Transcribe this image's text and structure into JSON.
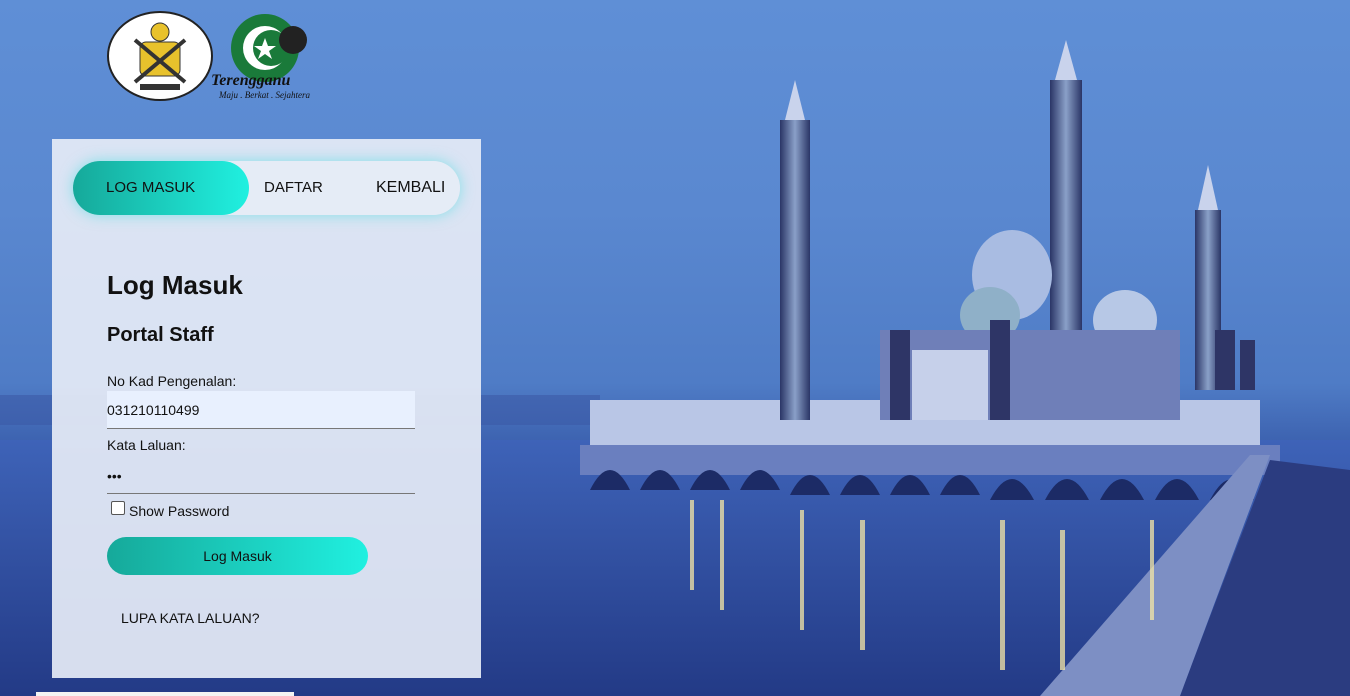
{
  "logo": {
    "state_crest_icon": "terengganu-crest",
    "brand_icon": "terengganu-brand-logo",
    "brand_text": "Terengganu",
    "tagline": "Maju . Berkat . Sejahtera"
  },
  "tabs": [
    {
      "label": "LOG MASUK",
      "active": true
    },
    {
      "label": "DAFTAR",
      "active": false
    },
    {
      "label": "KEMBALI",
      "active": false
    }
  ],
  "form": {
    "title": "Log Masuk",
    "subtitle": "Portal Staff",
    "ic_label": "No Kad Pengenalan:",
    "ic_value": "031210110499",
    "password_label": "Kata Laluan:",
    "password_mask": "•••",
    "show_password_label": "Show Password",
    "submit_label": "Log Masuk",
    "forgot_label": "LUPA KATA LALUAN?"
  },
  "colors": {
    "accent_start": "#16a99a",
    "accent_end": "#20f0e0",
    "panel": "#e6ecf6",
    "sky": "#5f8fd6"
  }
}
